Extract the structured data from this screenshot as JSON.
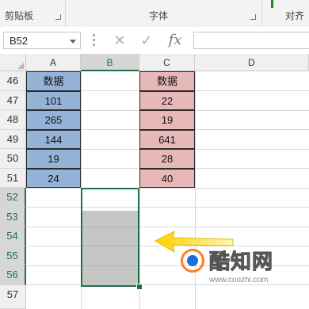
{
  "ribbon": {
    "groups": [
      {
        "label": "剪贴板"
      },
      {
        "label": "字体"
      },
      {
        "label": "对齐"
      }
    ]
  },
  "formula_bar": {
    "name_box": "B52",
    "cancel_icon": "close-icon",
    "confirm_icon": "check-icon",
    "fx_label": "fx",
    "formula": ""
  },
  "grid": {
    "columns": [
      "A",
      "B",
      "C",
      "D"
    ],
    "selected_column": "B",
    "rows": [
      "46",
      "47",
      "48",
      "49",
      "50",
      "51",
      "52",
      "53",
      "54",
      "55",
      "56",
      "57"
    ],
    "selected_rows": [
      "52",
      "53",
      "54",
      "55",
      "56"
    ],
    "col_a": [
      "数据",
      "101",
      "265",
      "144",
      "19",
      "24"
    ],
    "col_c": [
      "数据",
      "22",
      "19",
      "641",
      "28",
      "40"
    ],
    "colors": {
      "col_a_fill": "#95b3d7",
      "col_c_fill": "#e6b8b7",
      "selection": "#217346",
      "range_fill": "#c6c6c6"
    }
  },
  "watermark": {
    "brand": "酷知网",
    "url": "www.coozhi.com"
  }
}
